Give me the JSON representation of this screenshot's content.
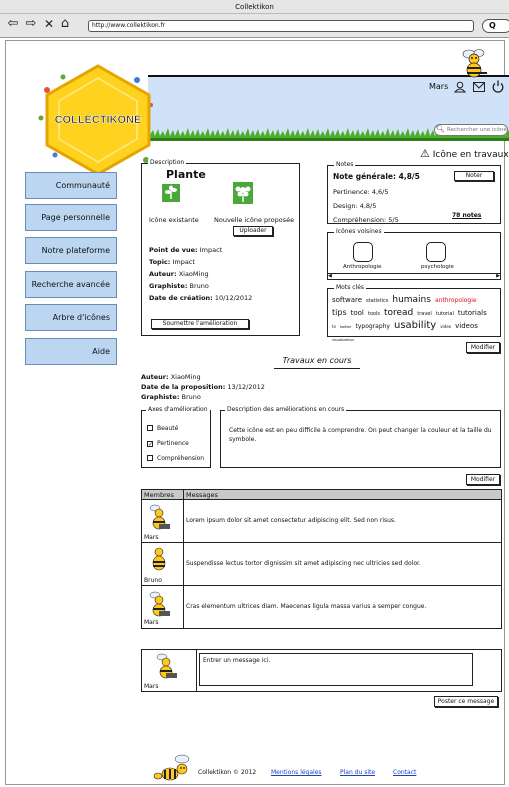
{
  "window": {
    "title": "Collektikon"
  },
  "browser": {
    "url": "http://www.collektikon.fr",
    "search_glyph": "Q"
  },
  "header": {
    "logo_text": "COLLECTIKONE",
    "user": "Mars",
    "search_placeholder": "Rechercher une icône",
    "status": "Icône en travaux",
    "warn_glyph": "⚠"
  },
  "sidebar": {
    "items": [
      {
        "label": "Communauté"
      },
      {
        "label": "Page personnelle"
      },
      {
        "label": "Notre plateforme"
      },
      {
        "label": "Recherche avancée"
      },
      {
        "label": "Arbre d'icônes"
      },
      {
        "label": "Aide"
      }
    ]
  },
  "description": {
    "legend": "Description",
    "title": "Plante",
    "existing_label": "Icône existante",
    "proposed_label": "Nouvelle icône proposée",
    "upload_button": "Uploader",
    "fields": [
      {
        "label": "Point de vue:",
        "value": "Impact"
      },
      {
        "label": "Topic:",
        "value": "Impact"
      },
      {
        "label": "Auteur:",
        "value": "XiaoMing"
      },
      {
        "label": "Graphiste:",
        "value": "Bruno"
      },
      {
        "label": "Date de création:",
        "value": "10/12/2012"
      }
    ],
    "submit_button": "Soumettre l'amélioration"
  },
  "notes": {
    "legend": "Notes",
    "overall_label": "Note générale:",
    "overall_value": "4,8/5",
    "rate_button": "Noter",
    "rows": [
      {
        "label": "Pertinence:",
        "value": "4,6/5"
      },
      {
        "label": "Design:",
        "value": "4,8/5"
      },
      {
        "label": "Compréhension:",
        "value": "5/5"
      }
    ],
    "count_link": "78 notes"
  },
  "neighbors": {
    "legend": "Icônes voisines",
    "items": [
      "Anthropologie",
      "psychologie"
    ]
  },
  "tags": {
    "legend": "Mots clés",
    "items": [
      {
        "t": "software",
        "s": 7
      },
      {
        "t": "statistics",
        "s": 5
      },
      {
        "t": "humains",
        "s": 9
      },
      {
        "t": "anthropologie",
        "s": 6,
        "c": "#d11"
      },
      {
        "t": "tips",
        "s": 8
      },
      {
        "t": "tool",
        "s": 7
      },
      {
        "t": "tools",
        "s": 5
      },
      {
        "t": "toread",
        "s": 9
      },
      {
        "t": "travel",
        "s": 5
      },
      {
        "t": "tutorial",
        "s": 5
      },
      {
        "t": "tutorials",
        "s": 7
      },
      {
        "t": "tv",
        "s": 4
      },
      {
        "t": "twitter",
        "s": 3.5
      },
      {
        "t": "typography",
        "s": 6
      },
      {
        "t": "usability",
        "s": 10
      },
      {
        "t": "video",
        "s": 4
      },
      {
        "t": "videos",
        "s": 7
      },
      {
        "t": "visualization",
        "s": 3.5
      }
    ]
  },
  "modify_button": "Modifier",
  "work": {
    "title": "Travaux en cours",
    "author_label": "Auteur:",
    "author_value": "XiaoMing",
    "date_label": "Date de la proposition:",
    "date_value": "13/12/2012",
    "graphist_label": "Graphiste:",
    "graphist_value": "Bruno",
    "axes_legend": "Axes d'amélioration",
    "axes": [
      {
        "label": "Beauté",
        "checked": false
      },
      {
        "label": "Pertinence",
        "checked": true
      },
      {
        "label": "Compréhension",
        "checked": false
      }
    ],
    "desc_legend": "Description des améliorations en cours",
    "desc_text": "Cette icône est en peu difficile à comprendre. On peut changer la couleur et la taille du symbole.",
    "modify_button": "Modifier"
  },
  "messages": {
    "col_members": "Membres",
    "col_messages": "Messages",
    "rows": [
      {
        "member": "Mars",
        "text": "Lorem ipsum dolor sit amet consectetur adipiscing elit. Sed non risus."
      },
      {
        "member": "Bruno",
        "text": "Suspendisse lectus tortor dignissim sit amet adipiscing nec ultricies sed dolor."
      },
      {
        "member": "Mars",
        "text": "Cras elementum ultrices diam. Maecenas ligula massa varius a semper congue."
      }
    ]
  },
  "compose": {
    "member": "Mars",
    "placeholder": "Entrer un message ici.",
    "post_button": "Poster ce message"
  },
  "footer": {
    "copyright": "Collektikon © 2012",
    "links": [
      "Mentions légales",
      "Plan du site",
      "Contact"
    ]
  },
  "colors": {
    "banner": "#cfe2f7",
    "nav": "#bcd6f2",
    "logo_yellow": "#ffd21f",
    "grass": "#4cae2b",
    "link": "#1a3fbf",
    "red_tag": "#dd1111"
  }
}
